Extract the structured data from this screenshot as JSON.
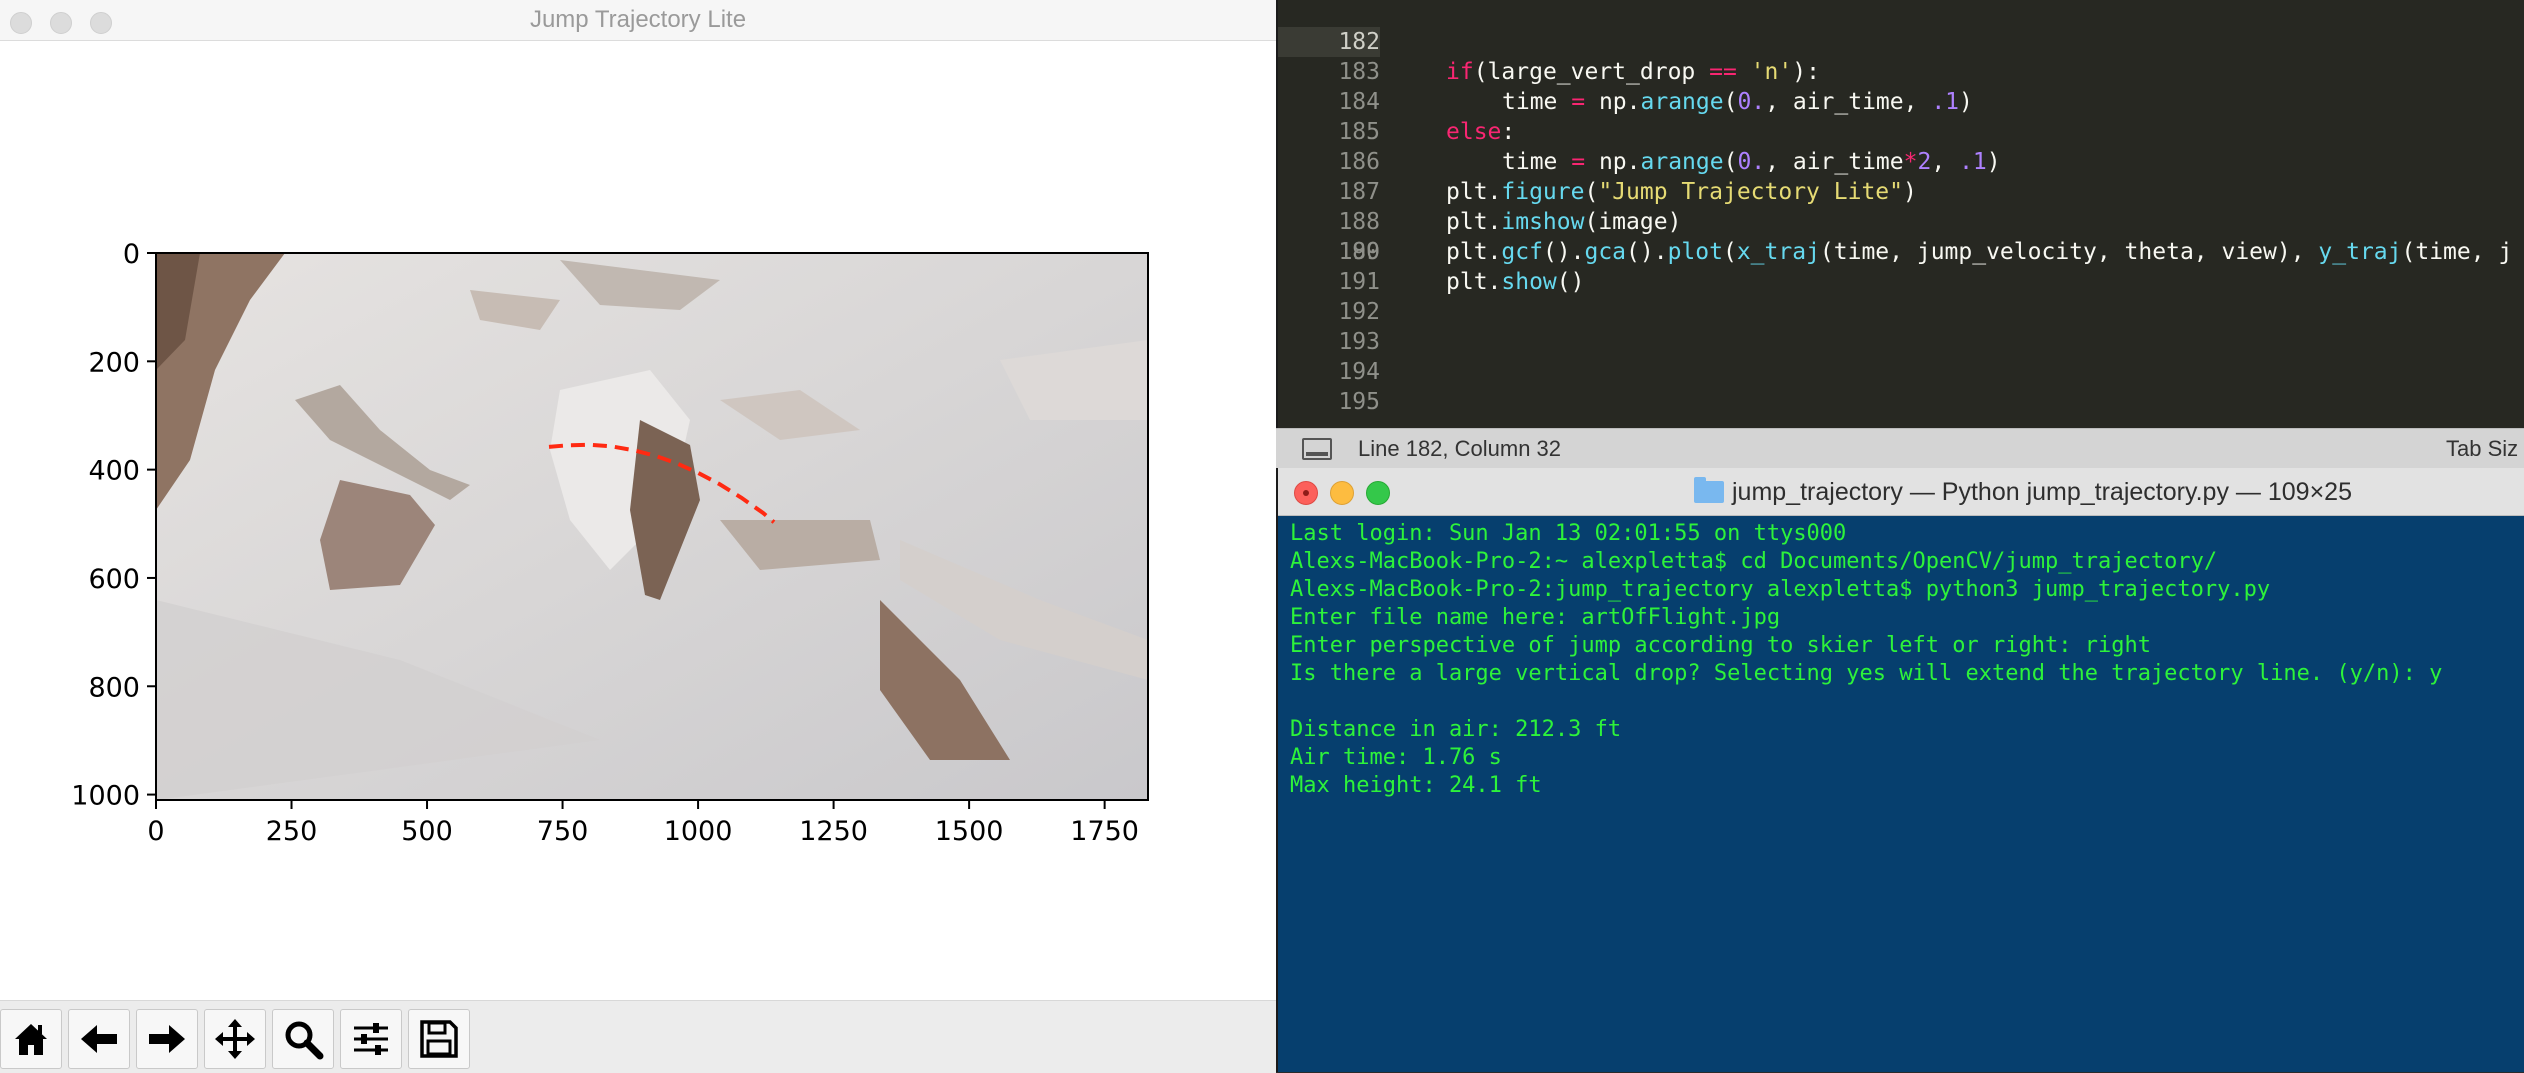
{
  "plot_window": {
    "title": "Jump Trajectory Lite",
    "toolbar": [
      {
        "name": "home-icon",
        "tooltip": "Home"
      },
      {
        "name": "back-arrow-icon",
        "tooltip": "Back"
      },
      {
        "name": "forward-arrow-icon",
        "tooltip": "Forward"
      },
      {
        "name": "pan-move-icon",
        "tooltip": "Pan"
      },
      {
        "name": "zoom-icon",
        "tooltip": "Zoom"
      },
      {
        "name": "subplots-sliders-icon",
        "tooltip": "Configure subplots"
      },
      {
        "name": "save-floppy-icon",
        "tooltip": "Save"
      }
    ]
  },
  "chart_data": {
    "type": "line",
    "title": "",
    "xlabel": "",
    "ylabel": "",
    "xlim": [
      0,
      1830
    ],
    "ylim": [
      1010,
      0
    ],
    "xticks": [
      0,
      250,
      500,
      750,
      1000,
      1250,
      1500,
      1750
    ],
    "yticks": [
      0,
      200,
      400,
      600,
      800,
      1000
    ],
    "background": "image of a snowy mountain slope",
    "series": [
      {
        "color": "#ff2a12",
        "style": "dashed",
        "x": [
          725,
          760,
          800,
          840,
          880,
          920,
          960,
          1000,
          1040,
          1080,
          1120,
          1140
        ],
        "y": [
          358,
          355,
          354,
          357,
          364,
          374,
          388,
          406,
          427,
          452,
          480,
          497
        ]
      }
    ]
  },
  "editor": {
    "lines": [
      {
        "num": "182",
        "current": true
      },
      {
        "num": "183"
      },
      {
        "num": "184"
      },
      {
        "num": "185"
      },
      {
        "num": "186"
      },
      {
        "num": "187"
      },
      {
        "num": "188"
      },
      {
        "num": "189"
      },
      {
        "num": "190"
      },
      {
        "num": "191"
      },
      {
        "num": "192"
      },
      {
        "num": "193"
      },
      {
        "num": "194"
      },
      {
        "num": "195"
      }
    ],
    "code": {
      "l182_kw": "if",
      "l182_mid": "(large_vert_drop ",
      "l182_op": "==",
      "l182_str": "'n'",
      "l182_end": "):",
      "l183_a": "time ",
      "l183_op": "=",
      "l183_b": " np.",
      "l183_fn": "arange",
      "l183_c": "(",
      "l183_n1": "0.",
      "l183_d": ", air_time, ",
      "l183_n2": ".1",
      "l183_e": ")",
      "l184_kw": "else",
      "l184_end": ":",
      "l185_a": "time ",
      "l185_op": "=",
      "l185_b": " np.",
      "l185_fn": "arange",
      "l185_c": "(",
      "l185_n1": "0.",
      "l185_d": ", air_time",
      "l185_op2": "*",
      "l185_n2": "2",
      "l185_e": ", ",
      "l185_n3": ".1",
      "l185_f": ")",
      "l186_a": "plt.",
      "l186_fn": "figure",
      "l186_b": "(",
      "l186_str": "\"Jump Trajectory Lite\"",
      "l186_c": ")",
      "l187_a": "plt.",
      "l187_fn": "imshow",
      "l187_b": "(image)",
      "l188_a": "plt.",
      "l188_fn1": "gcf",
      "l188_b": "().",
      "l188_fn2": "gca",
      "l188_c": "().",
      "l188_fn3": "plot",
      "l188_d": "(",
      "l188_fn4": "x_traj",
      "l188_e": "(time, jump_velocity, theta, view), ",
      "l188_fn5": "y_traj",
      "l188_f": "(time, j",
      "l189_a": "plt.",
      "l189_fn": "show",
      "l189_b": "()"
    },
    "status": "Line 182, Column 32",
    "tab_size": "Tab Siz"
  },
  "terminal": {
    "title": "jump_trajectory — Python jump_trajectory.py — 109×25",
    "lines": [
      "Last login: Sun Jan 13 02:01:55 on ttys000",
      "Alexs-MacBook-Pro-2:~ alexpletta$ cd Documents/OpenCV/jump_trajectory/",
      "Alexs-MacBook-Pro-2:jump_trajectory alexpletta$ python3 jump_trajectory.py",
      "Enter file name here: artOfFlight.jpg",
      "Enter perspective of jump according to skier left or right: right",
      "Is there a large vertical drop? Selecting yes will extend the trajectory line. (y/n): y",
      "",
      "Distance in air: 212.3 ft",
      "Air time: 1.76 s",
      "Max height: 24.1 ft"
    ]
  }
}
